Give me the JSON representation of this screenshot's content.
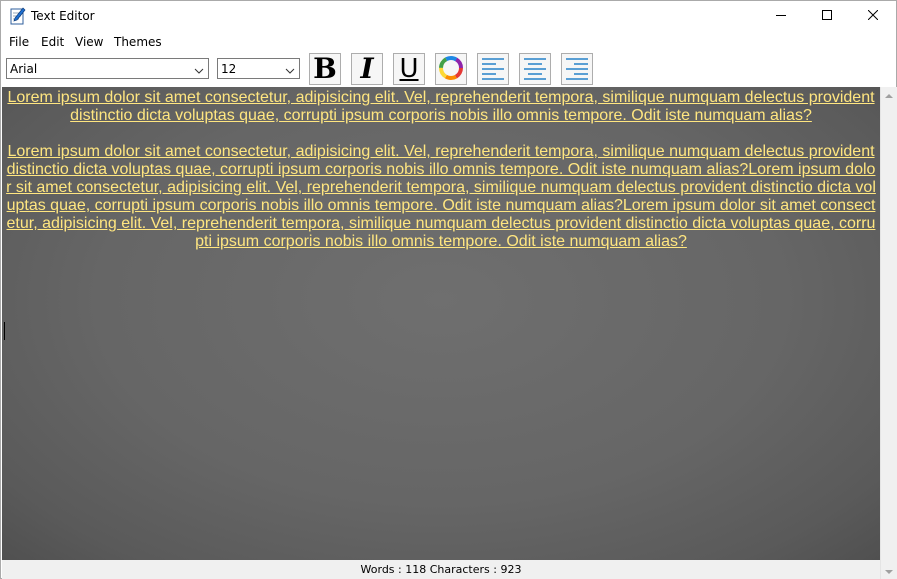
{
  "window": {
    "title": "Text Editor"
  },
  "menu": [
    "File",
    "Edit",
    "View",
    "Themes"
  ],
  "toolbar": {
    "font_family": "Arial",
    "font_size": "12",
    "bold_label": "B",
    "italic_label": "I",
    "underline_label": "U"
  },
  "editor": {
    "paragraphs": [
      "Lorem ipsum dolor sit amet consectetur, adipisicing elit. Vel, reprehenderit tempora, similique numquam delectus provident distinctio dicta voluptas quae, corrupti ipsum corporis nobis illo omnis tempore. Odit iste numquam alias?",
      "Lorem ipsum dolor sit amet consectetur, adipisicing elit. Vel, reprehenderit tempora, similique numquam delectus provident distinctio dicta voluptas quae, corrupti ipsum corporis nobis illo omnis tempore. Odit iste numquam alias?Lorem ipsum dolor sit amet consectetur, adipisicing elit. Vel, reprehenderit tempora, similique numquam delectus provident distinctio dicta voluptas quae, corrupti ipsum corporis nobis illo omnis tempore. Odit iste numquam alias?Lorem ipsum dolor sit amet consectetur, adipisicing elit. Vel, reprehenderit tempora, similique numquam delectus provident distinctio dicta voluptas quae, corrupti ipsum corporis nobis illo omnis tempore. Odit iste numquam alias?"
    ],
    "text_color": "#ffe680",
    "background_color": "#666666",
    "alignment": "center"
  },
  "status": {
    "text": "Words : 118 Characters : 923"
  },
  "icons": {
    "app": "pen-notepad-icon",
    "minimize": "minimize-icon",
    "maximize": "maximize-icon",
    "close": "close-icon",
    "color": "color-wheel-icon",
    "align_left": "align-left-icon",
    "align_center": "align-center-icon",
    "align_right": "align-right-icon"
  }
}
